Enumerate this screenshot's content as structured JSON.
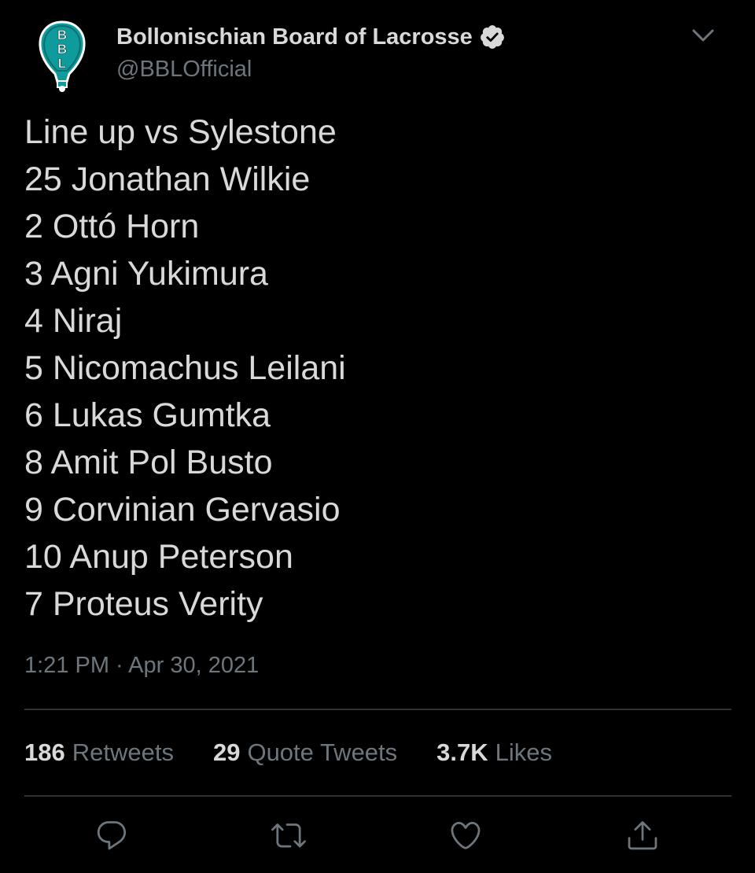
{
  "author": {
    "display_name": "Bollonischian Board of Lacrosse",
    "handle": "@BBLOfficial",
    "verified": true,
    "avatar_letters": [
      "B",
      "B",
      "L"
    ]
  },
  "tweet": {
    "lines": [
      "Line up vs Sylestone",
      "25 Jonathan Wilkie",
      "2 Ottó Horn",
      "3 Agni Yukimura",
      "4 Niraj",
      "5 Nicomachus Leilani",
      "6 Lukas Gumtka",
      "8 Amit Pol Busto",
      "9 Corvinian Gervasio",
      "10 Anup Peterson",
      "7 Proteus Verity"
    ],
    "timestamp": "1:21 PM · Apr 30, 2021"
  },
  "stats": {
    "retweets": {
      "count": "186",
      "label": "Retweets"
    },
    "quote_tweets": {
      "count": "29",
      "label": "Quote Tweets"
    },
    "likes": {
      "count": "3.7K",
      "label": "Likes"
    }
  },
  "actions": {
    "reply": "reply-icon",
    "retweet": "retweet-icon",
    "like": "heart-icon",
    "share": "share-icon"
  },
  "colors": {
    "background": "#000000",
    "primary_text": "#d9d9d9",
    "secondary_text": "#6e767d",
    "divider": "#2f3336",
    "avatar_fill": "#0f9a9b"
  }
}
